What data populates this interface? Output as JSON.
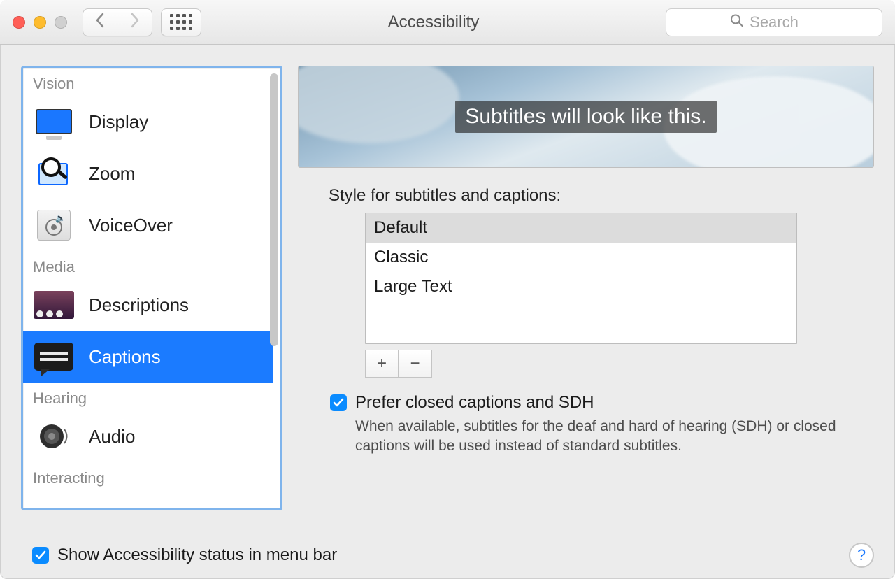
{
  "window": {
    "title": "Accessibility"
  },
  "toolbar": {
    "search_placeholder": "Search"
  },
  "sidebar": {
    "sections": [
      {
        "label": "Vision",
        "items": [
          {
            "id": "display",
            "label": "Display",
            "icon": "display-icon",
            "selected": false
          },
          {
            "id": "zoom",
            "label": "Zoom",
            "icon": "zoom-icon",
            "selected": false
          },
          {
            "id": "voiceover",
            "label": "VoiceOver",
            "icon": "voiceover-icon",
            "selected": false
          }
        ]
      },
      {
        "label": "Media",
        "items": [
          {
            "id": "descriptions",
            "label": "Descriptions",
            "icon": "descriptions-icon",
            "selected": false
          },
          {
            "id": "captions",
            "label": "Captions",
            "icon": "captions-icon",
            "selected": true
          }
        ]
      },
      {
        "label": "Hearing",
        "items": [
          {
            "id": "audio",
            "label": "Audio",
            "icon": "audio-icon",
            "selected": false
          }
        ]
      },
      {
        "label": "Interacting",
        "items": []
      }
    ]
  },
  "main": {
    "preview_text": "Subtitles will look like this.",
    "style_label": "Style for subtitles and captions:",
    "styles": [
      {
        "label": "Default",
        "selected": true
      },
      {
        "label": "Classic",
        "selected": false
      },
      {
        "label": "Large Text",
        "selected": false
      }
    ],
    "add_label": "+",
    "remove_label": "−",
    "prefer_cc": {
      "checked": true,
      "label": "Prefer closed captions and SDH",
      "description": "When available, subtitles for the deaf and hard of hearing (SDH) or closed captions will be used instead of standard subtitles."
    }
  },
  "footer": {
    "show_status": {
      "checked": true,
      "label": "Show Accessibility status in menu bar"
    },
    "help_label": "?"
  },
  "colors": {
    "accent": "#0a8bff",
    "selection": "#1b7bff"
  }
}
